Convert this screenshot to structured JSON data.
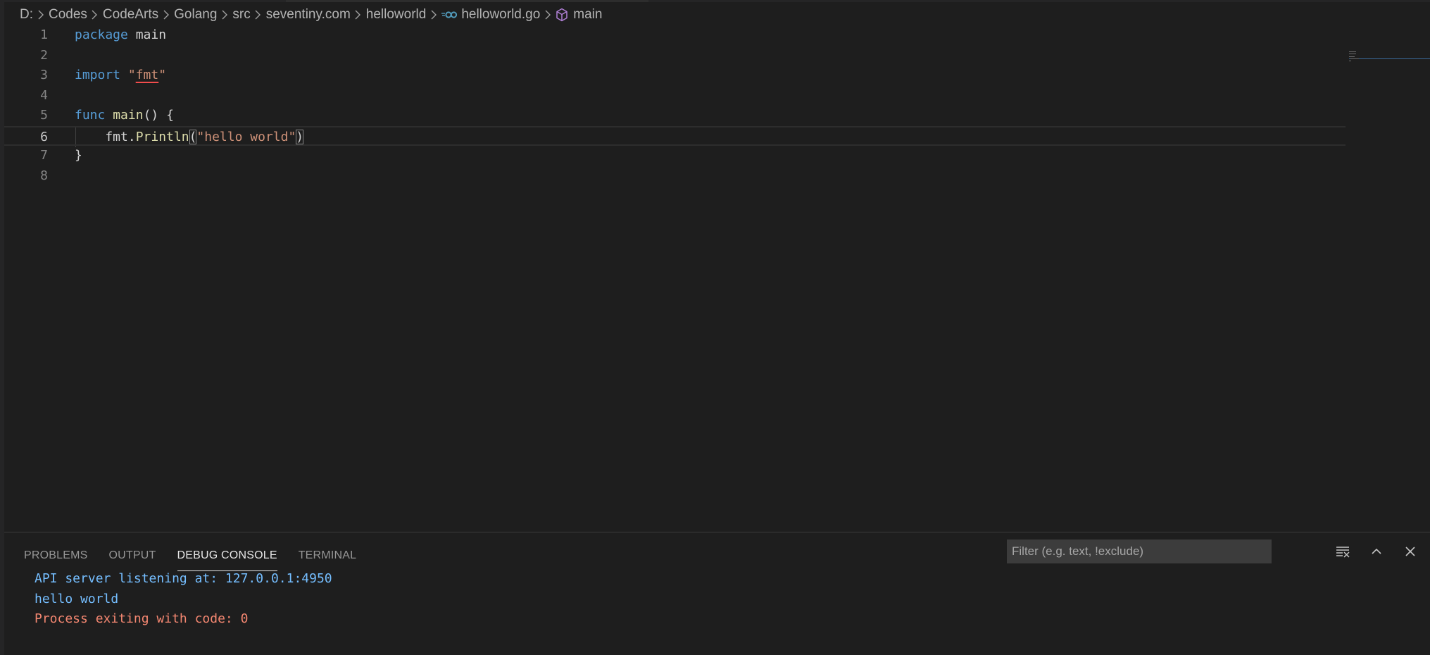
{
  "breadcrumb": {
    "items": [
      "D:",
      "Codes",
      "CodeArts",
      "Golang",
      "src",
      "seventiny.com",
      "helloworld"
    ],
    "file": "helloworld.go",
    "symbol": "main"
  },
  "editor": {
    "lines": [
      {
        "number": "1",
        "tokens": [
          {
            "text": "package",
            "type": "kw"
          },
          {
            "text": " main",
            "type": "ident"
          }
        ]
      },
      {
        "number": "2",
        "tokens": []
      },
      {
        "number": "3",
        "tokens": [
          {
            "text": "import",
            "type": "kw"
          },
          {
            "text": " ",
            "type": "ident"
          },
          {
            "text": "\"",
            "type": "str"
          },
          {
            "text": "fmt",
            "type": "str-squiggle"
          },
          {
            "text": "\"",
            "type": "str"
          }
        ]
      },
      {
        "number": "4",
        "tokens": []
      },
      {
        "number": "5",
        "tokens": [
          {
            "text": "func",
            "type": "kw"
          },
          {
            "text": " ",
            "type": "ident"
          },
          {
            "text": "main",
            "type": "fn"
          },
          {
            "text": "() {",
            "type": "ident"
          }
        ]
      },
      {
        "number": "6",
        "tokens": [
          {
            "text": "    fmt.",
            "type": "ident"
          },
          {
            "text": "Println",
            "type": "fn"
          },
          {
            "text": "(",
            "type": "bracket"
          },
          {
            "text": "\"hello world\"",
            "type": "str"
          },
          {
            "text": ")",
            "type": "bracket"
          }
        ],
        "current": true
      },
      {
        "number": "7",
        "tokens": [
          {
            "text": "}",
            "type": "ident"
          }
        ]
      },
      {
        "number": "8",
        "tokens": []
      }
    ]
  },
  "panel": {
    "tabs": [
      {
        "label": "PROBLEMS",
        "active": false
      },
      {
        "label": "OUTPUT",
        "active": false
      },
      {
        "label": "DEBUG CONSOLE",
        "active": true
      },
      {
        "label": "TERMINAL",
        "active": false
      }
    ],
    "filter_placeholder": "Filter (e.g. text, !exclude)",
    "actions": [
      "clear-console-icon",
      "maximize-panel-icon",
      "close-panel-icon"
    ],
    "console_lines": [
      {
        "text": "API server listening at: 127.0.0.1:4950",
        "color": "#75beff"
      },
      {
        "text": "hello world",
        "color": "#75beff"
      },
      {
        "text": "Process exiting with code: 0",
        "color": "#f48771"
      }
    ]
  },
  "colors": {
    "background": "#1e1e1e",
    "keyword": "#569cd6",
    "string": "#ce9178",
    "function": "#dcdcaa",
    "line_number": "#858585",
    "info": "#75beff",
    "warning": "#f48771"
  }
}
